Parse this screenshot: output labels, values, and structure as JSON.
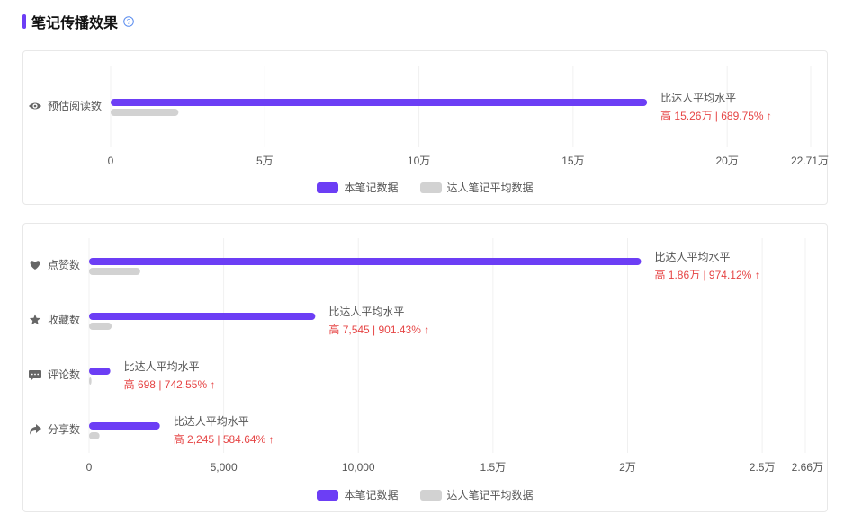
{
  "section": {
    "title": "笔记传播效果"
  },
  "legend": {
    "note": "本笔记数据",
    "avg": "达人笔记平均数据"
  },
  "colors": {
    "accent": "#6c3ef5",
    "avg_bar": "#d2d2d2",
    "up": "#e64545",
    "grid": "#f0f0f0"
  },
  "chart_data": [
    {
      "type": "bar",
      "orientation": "horizontal",
      "categories": [
        "预估阅读数"
      ],
      "category_icons": [
        "eye-icon"
      ],
      "series": [
        {
          "name": "本笔记数据",
          "values": [
            174000
          ]
        },
        {
          "name": "达人笔记平均数据",
          "values": [
            22000
          ]
        }
      ],
      "xlim": [
        0,
        227100
      ],
      "tick_values": [
        0,
        50000,
        100000,
        150000,
        200000,
        227100
      ],
      "tick_labels": [
        "0",
        "5万",
        "10万",
        "15万",
        "20万",
        "22.71万"
      ],
      "annotations": [
        {
          "line1": "比达人平均水平",
          "line2": "高 15.26万 | 689.75% ↑"
        }
      ],
      "legend_position": "bottom",
      "grid": true
    },
    {
      "type": "bar",
      "orientation": "horizontal",
      "categories": [
        "点赞数",
        "收藏数",
        "评论数",
        "分享数"
      ],
      "category_icons": [
        "heart-icon",
        "star-icon",
        "comment-icon",
        "share-icon"
      ],
      "series": [
        {
          "name": "本笔记数据",
          "values": [
            20500,
            8400,
            790,
            2630
          ]
        },
        {
          "name": "达人笔记平均数据",
          "values": [
            1900,
            840,
            90,
            390
          ]
        }
      ],
      "xlim": [
        0,
        26600
      ],
      "tick_values": [
        0,
        5000,
        10000,
        15000,
        20000,
        25000,
        26600
      ],
      "tick_labels": [
        "0",
        "5,000",
        "10,000",
        "1.5万",
        "2万",
        "2.5万",
        "2.66万"
      ],
      "annotations": [
        {
          "line1": "比达人平均水平",
          "line2": "高 1.86万 | 974.12% ↑"
        },
        {
          "line1": "比达人平均水平",
          "line2": "高 7,545 | 901.43% ↑"
        },
        {
          "line1": "比达人平均水平",
          "line2": "高 698 | 742.55% ↑"
        },
        {
          "line1": "比达人平均水平",
          "line2": "高 2,245 | 584.64% ↑"
        }
      ],
      "legend_position": "bottom",
      "grid": true
    }
  ]
}
